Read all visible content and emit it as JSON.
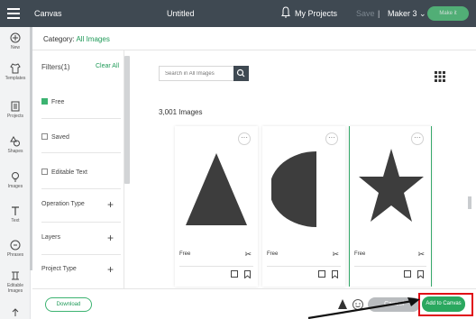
{
  "topbar": {
    "app_name": "Canvas",
    "document_title": "Untitled",
    "my_projects": "My Projects",
    "save": "Save",
    "separator": "|",
    "machine": "Maker 3",
    "make_it": "Make it"
  },
  "rail": {
    "items": [
      {
        "label": "New",
        "icon": "plus-circle-icon"
      },
      {
        "label": "Templates",
        "icon": "shirt-icon"
      },
      {
        "label": "Projects",
        "icon": "projects-icon"
      },
      {
        "label": "Shapes",
        "icon": "shapes-icon"
      },
      {
        "label": "Images",
        "icon": "lightbulb-icon"
      },
      {
        "label": "Text",
        "icon": "text-icon"
      },
      {
        "label": "Phrases",
        "icon": "phrases-icon"
      },
      {
        "label": "Editable Images",
        "icon": "editable-images-icon"
      }
    ]
  },
  "category": {
    "prefix": "Category:",
    "value": "All Images"
  },
  "filters": {
    "title": "Filters(1)",
    "clear_all": "Clear All",
    "checkboxes": [
      {
        "label": "Free",
        "checked": true
      },
      {
        "label": "Saved",
        "checked": false
      },
      {
        "label": "Editable Text",
        "checked": false
      }
    ],
    "expandable": [
      {
        "label": "Operation Type"
      },
      {
        "label": "Layers"
      },
      {
        "label": "Project Type"
      }
    ]
  },
  "main": {
    "search_placeholder": "Search in All Images",
    "count_text": "3,001 Images",
    "cards": [
      {
        "label": "Free",
        "shape": "triangle",
        "selected": false
      },
      {
        "label": "Free",
        "shape": "half-circle",
        "selected": false
      },
      {
        "label": "Free",
        "shape": "star",
        "selected": true
      }
    ]
  },
  "bottombar": {
    "download": "Download",
    "cancel": "Cancel",
    "add_to_canvas": "Add to Canvas"
  },
  "colors": {
    "topbar": "#3f4952",
    "accent_green": "#2aa85f",
    "highlight_red": "#e00b16"
  }
}
